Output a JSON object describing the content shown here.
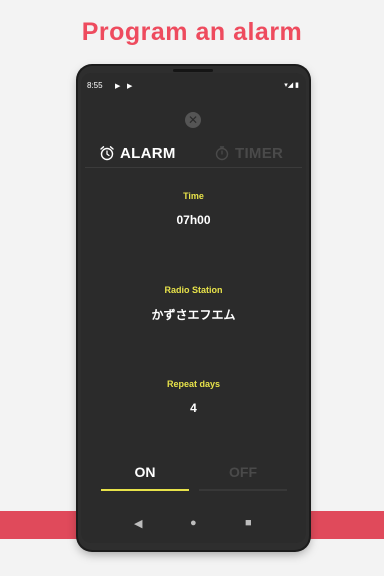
{
  "promo": {
    "title": "Program an alarm"
  },
  "status_bar": {
    "time": "8:55",
    "play_icons": [
      "▶",
      "▶"
    ],
    "right_icons": "▾◢ ▮"
  },
  "close_button": {
    "glyph": "✕"
  },
  "tabs": [
    {
      "label": "ALARM",
      "active": true,
      "icon": "alarm-clock-icon"
    },
    {
      "label": "TIMER",
      "active": false,
      "icon": "stopwatch-icon"
    }
  ],
  "fields": {
    "time": {
      "label": "Time",
      "value": "07h00"
    },
    "radio": {
      "label": "Radio Station",
      "value": "かずさエフエム"
    },
    "repeat": {
      "label": "Repeat days",
      "value": "4"
    }
  },
  "toggle": {
    "on_label": "ON",
    "off_label": "OFF",
    "selected": "ON"
  },
  "nav": {
    "back": "◀",
    "home": "●",
    "recents": "■"
  },
  "colors": {
    "accent": "#e7e24a",
    "brand_red": "#ee4b5e",
    "screen_bg": "#2b2b2b",
    "inactive": "#4a4a4a"
  }
}
